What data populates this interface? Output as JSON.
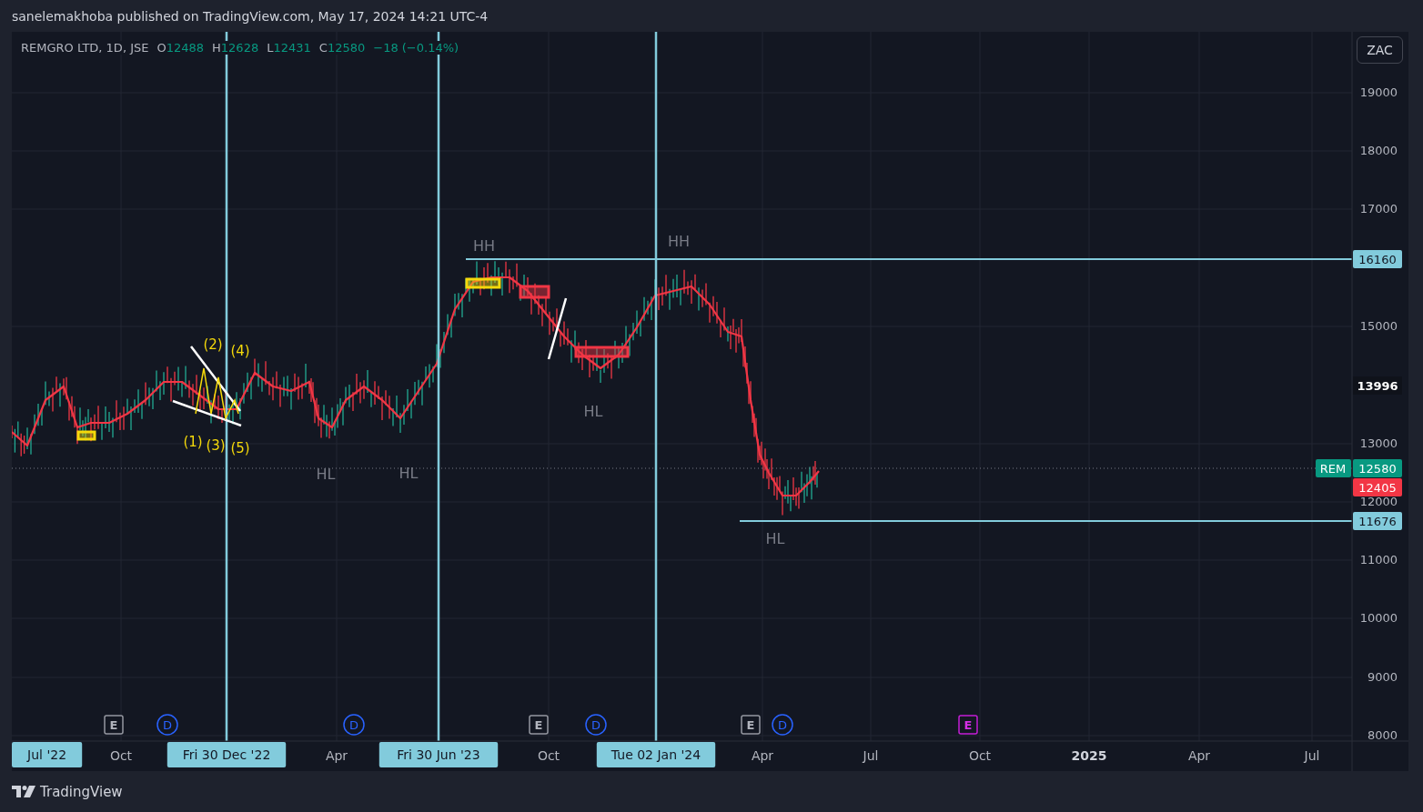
{
  "header": {
    "text": "sanelemakhoba published on TradingView.com, May 17, 2024 14:21 UTC-4"
  },
  "legend": {
    "symbol": "REMGRO LTD, 1D, JSE",
    "values": [
      {
        "key": "O",
        "value": "12488"
      },
      {
        "key": "H",
        "value": "12628"
      },
      {
        "key": "L",
        "value": "12431"
      },
      {
        "key": "C",
        "value": "12580"
      }
    ],
    "change": "−18 (−0.14%)"
  },
  "currency_button": "ZAC",
  "chart": {
    "price_axis": [
      "19000",
      "18000",
      "17000",
      "15000",
      "13000",
      "12000",
      "11000",
      "10000",
      "9000",
      "8000"
    ],
    "time_axis": [
      {
        "label": "Oct",
        "kind": "month"
      },
      {
        "label": "Apr",
        "kind": "month"
      },
      {
        "label": "Oct",
        "kind": "month"
      },
      {
        "label": "Apr",
        "kind": "month"
      },
      {
        "label": "Jul",
        "kind": "month"
      },
      {
        "label": "Oct",
        "kind": "month"
      },
      {
        "label": "2025",
        "kind": "year"
      },
      {
        "label": "Apr",
        "kind": "month"
      },
      {
        "label": "Jul",
        "kind": "month"
      }
    ],
    "date_tags": [
      "Jul '22",
      "Fri 30 Dec '22",
      "Fri 30 Jun '23",
      "Tue 02 Jan '24"
    ],
    "labels": [
      {
        "text": "HH",
        "kind": "pivot"
      },
      {
        "text": "HH",
        "kind": "pivot"
      },
      {
        "text": "HL",
        "kind": "pivot"
      },
      {
        "text": "HL",
        "kind": "pivot"
      },
      {
        "text": "HL",
        "kind": "pivot"
      },
      {
        "text": "HL",
        "kind": "pivot"
      },
      {
        "text": "(2)",
        "kind": "wave"
      },
      {
        "text": "(4)",
        "kind": "wave"
      },
      {
        "text": "(1)",
        "kind": "wave"
      },
      {
        "text": "(3)",
        "kind": "wave"
      },
      {
        "text": "(5)",
        "kind": "wave"
      }
    ],
    "price_labels": [
      {
        "kind": "line",
        "text": "16160"
      },
      {
        "kind": "cursor",
        "text": "13996"
      },
      {
        "kind": "last",
        "tag": "REM",
        "text": "12580"
      },
      {
        "kind": "ma",
        "text": "12405"
      },
      {
        "kind": "line",
        "text": "11676"
      }
    ],
    "events": [
      {
        "label": "E",
        "kind": "earnings",
        "future": false
      },
      {
        "label": "D",
        "kind": "dividend",
        "future": false
      },
      {
        "label": "D",
        "kind": "dividend",
        "future": false
      },
      {
        "label": "E",
        "kind": "earnings",
        "future": false
      },
      {
        "label": "D",
        "kind": "dividend",
        "future": false
      },
      {
        "label": "E",
        "kind": "earnings",
        "future": false
      },
      {
        "label": "D",
        "kind": "dividend",
        "future": false
      },
      {
        "label": "E",
        "kind": "earnings",
        "future": true
      }
    ]
  },
  "footer": {
    "brand": "TradingView"
  }
}
